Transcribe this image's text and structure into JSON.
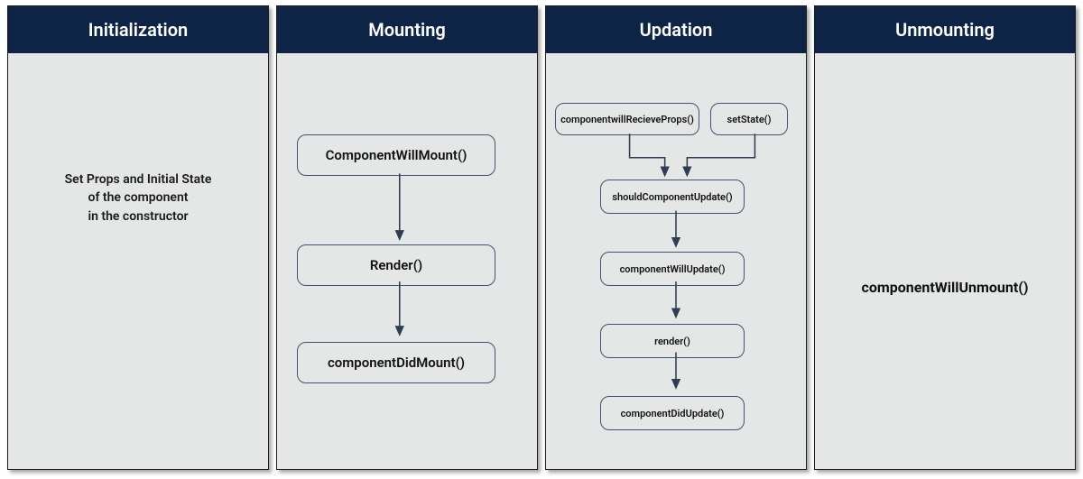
{
  "columns": {
    "initialization": {
      "title": "Initialization",
      "text": "Set Props and Initial State\nof the component\nin the constructor"
    },
    "mounting": {
      "title": "Mounting",
      "nodes": {
        "willMount": "ComponentWillMount()",
        "render": "Render()",
        "didMount": "componentDidMount()"
      }
    },
    "updation": {
      "title": "Updation",
      "nodes": {
        "willReceiveProps": "componentwillRecieveProps()",
        "setState": "setState()",
        "shouldUpdate": "shouldComponentUpdate()",
        "willUpdate": "componentWillUpdate()",
        "render": "render()",
        "didUpdate": "componentDidUpdate()"
      }
    },
    "unmounting": {
      "title": "Unmounting",
      "text": "componentWillUnmount()"
    }
  },
  "colors": {
    "headerBg": "#0d2446",
    "columnBg": "#e5e6e6",
    "border": "#43546f"
  }
}
